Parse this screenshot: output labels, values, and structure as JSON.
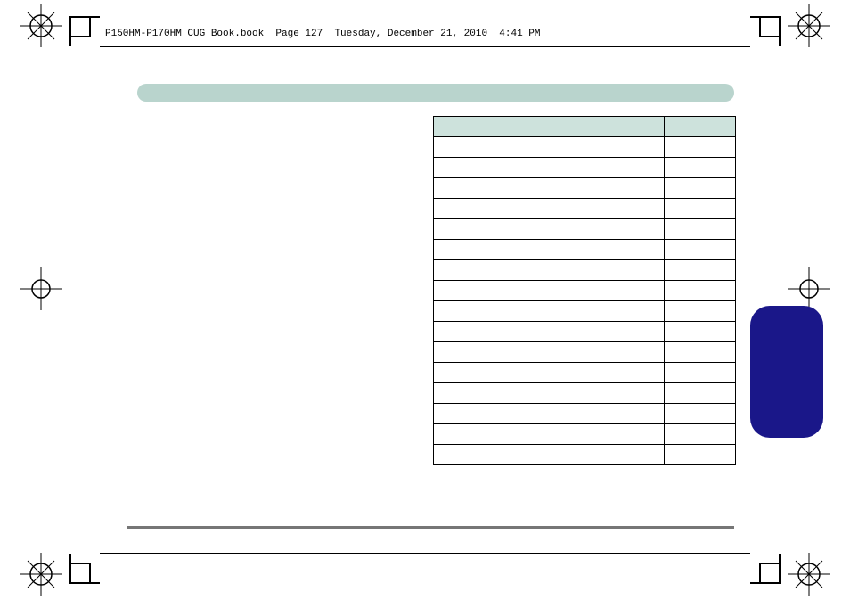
{
  "header": {
    "text": "P150HM-P170HM CUG Book.book  Page 127  Tuesday, December 21, 2010  4:41 PM"
  },
  "section": {
    "title": ""
  },
  "table": {
    "headers": [
      "",
      ""
    ],
    "rows": [
      [
        "",
        ""
      ],
      [
        "",
        ""
      ],
      [
        "",
        ""
      ],
      [
        "",
        ""
      ],
      [
        "",
        ""
      ],
      [
        "",
        ""
      ],
      [
        "",
        ""
      ],
      [
        "",
        ""
      ],
      [
        "",
        ""
      ],
      [
        "",
        ""
      ],
      [
        "",
        ""
      ],
      [
        "",
        ""
      ],
      [
        "",
        ""
      ],
      [
        "",
        ""
      ],
      [
        "",
        ""
      ],
      [
        "",
        ""
      ]
    ]
  },
  "tab": {
    "label": ""
  }
}
